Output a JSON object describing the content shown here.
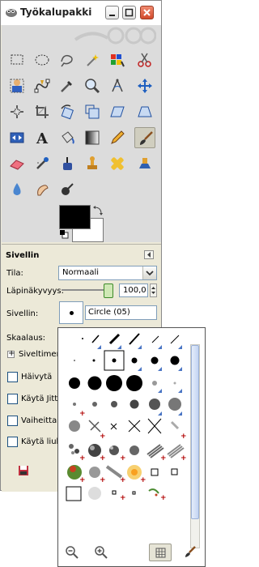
{
  "window": {
    "title": "Työkalupakki",
    "controls": {
      "minimize": "minimize",
      "maximize": "maximize",
      "close": "close"
    }
  },
  "toolbox": {
    "tools": [
      "rect-select-icon",
      "ellipse-select-icon",
      "free-select-icon",
      "fuzzy-select-icon",
      "select-by-color-icon",
      "scissors-icon",
      "foreground-select-icon",
      "paths-icon",
      "color-picker-icon",
      "zoom-icon",
      "measure-icon",
      "move-icon",
      "align-icon",
      "crop-icon",
      "rotate-icon",
      "scale-icon",
      "shear-icon",
      "perspective-icon",
      "flip-icon",
      "text-icon",
      "bucket-fill-icon",
      "blend-icon",
      "pencil-icon",
      "paintbrush-icon",
      "eraser-icon",
      "airbrush-icon",
      "ink-icon",
      "clone-icon",
      "heal-icon",
      "perspective-clone-icon",
      "blur-icon",
      "smudge-icon",
      "dodge-burn-icon"
    ],
    "active_tool": "paintbrush-icon",
    "colors": {
      "foreground": "#000000",
      "background": "#ffffff"
    }
  },
  "options": {
    "section_title": "Sivellin",
    "mode_label": "Tila:",
    "mode_value": "Normaali",
    "opacity_label": "Läpinäkyvyys:",
    "opacity_value": "100,0",
    "opacity_level": 1.0,
    "brush_label": "Sivellin:",
    "brush_value": "Circle (05)",
    "scale_label": "Skaalaus:",
    "brush_dynamics_label": "Siveltimen",
    "checkboxes": [
      {
        "label": "Häivytä",
        "checked": false
      },
      {
        "label": "Käytä Jitte",
        "checked": false
      },
      {
        "label": "Vaiheittain",
        "checked": false
      },
      {
        "label": "Käytä liuku",
        "checked": false
      }
    ]
  },
  "brush_popup": {
    "footer_buttons": [
      "zoom-out-icon",
      "zoom-in-icon",
      "grid-view-icon",
      "edit-brush-icon"
    ],
    "selected_footer": "grid-view-icon"
  }
}
